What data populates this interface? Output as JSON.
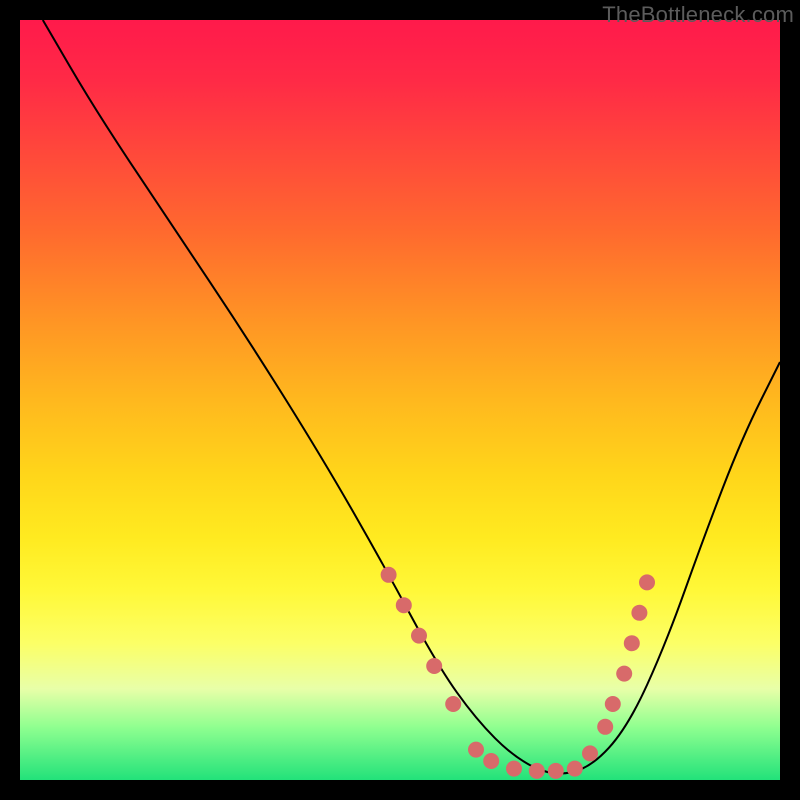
{
  "watermark": "TheBottleneck.com",
  "chart_data": {
    "type": "line",
    "title": "",
    "xlabel": "",
    "ylabel": "",
    "xlim": [
      0,
      100
    ],
    "ylim": [
      0,
      100
    ],
    "grid": false,
    "legend": false,
    "series": [
      {
        "name": "curve",
        "x": [
          3,
          10,
          20,
          30,
          40,
          48,
          55,
          60,
          65,
          70,
          75,
          80,
          85,
          90,
          95,
          100
        ],
        "y": [
          100,
          88,
          73,
          58,
          42,
          28,
          15,
          8,
          3,
          0.5,
          1.5,
          7,
          18,
          32,
          45,
          55
        ],
        "color": "#000000"
      }
    ],
    "markers": [
      {
        "x": 48.5,
        "y": 27
      },
      {
        "x": 50.5,
        "y": 23
      },
      {
        "x": 52.5,
        "y": 19
      },
      {
        "x": 54.5,
        "y": 15
      },
      {
        "x": 57.0,
        "y": 10
      },
      {
        "x": 60.0,
        "y": 4
      },
      {
        "x": 62.0,
        "y": 2.5
      },
      {
        "x": 65.0,
        "y": 1.5
      },
      {
        "x": 68.0,
        "y": 1.2
      },
      {
        "x": 70.5,
        "y": 1.2
      },
      {
        "x": 73.0,
        "y": 1.5
      },
      {
        "x": 75.0,
        "y": 3.5
      },
      {
        "x": 77.0,
        "y": 7
      },
      {
        "x": 78.0,
        "y": 10
      },
      {
        "x": 79.5,
        "y": 14
      },
      {
        "x": 80.5,
        "y": 18
      },
      {
        "x": 81.5,
        "y": 22
      },
      {
        "x": 82.5,
        "y": 26
      }
    ],
    "marker_style": {
      "color": "#d86a6a",
      "radius": 8
    },
    "background_gradient": {
      "top": "#ff1a4b",
      "middle": "#ffd61a",
      "bottom": "#22e27a"
    }
  }
}
